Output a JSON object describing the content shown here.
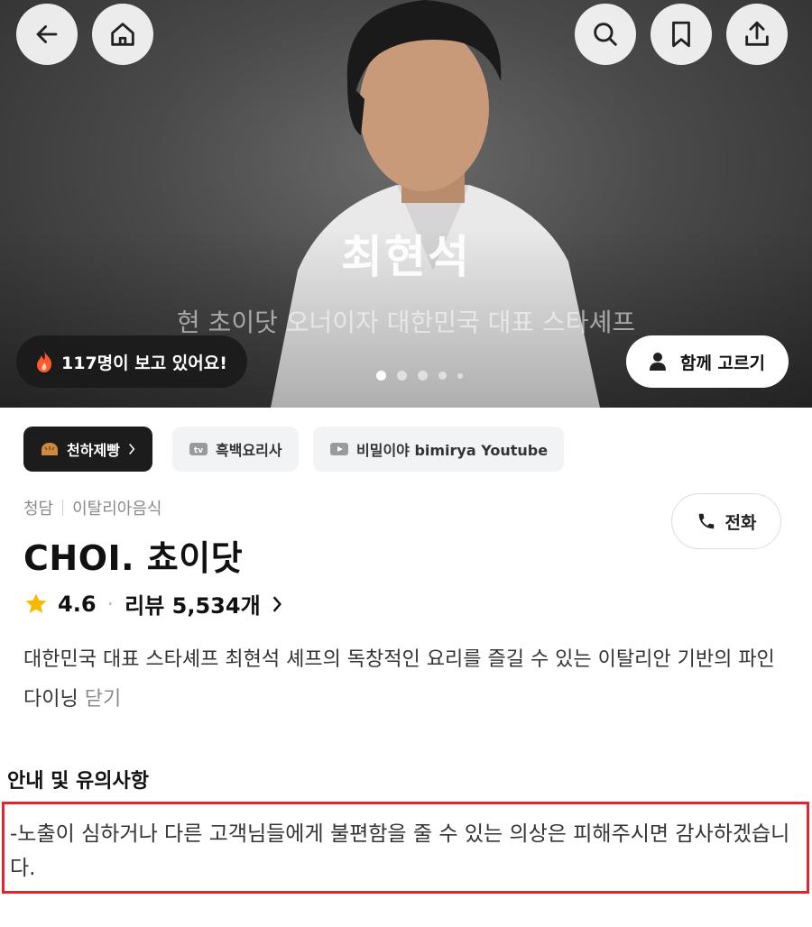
{
  "hero": {
    "title": "최현석",
    "subtitle": "현 초이닷 오너이자 대한민국 대표 스타셰프",
    "viewers": "117명이 보고 있어요!",
    "together_button": "함께 고르기",
    "carousel": {
      "total": 5,
      "active": 1
    }
  },
  "top_actions": {
    "back": "back-icon",
    "home": "home-icon",
    "search": "search-icon",
    "bookmark": "bookmark-icon",
    "share": "share-icon"
  },
  "chips": [
    {
      "label": "천하제빵",
      "icon": "bread-icon"
    },
    {
      "label": "흑백요리사",
      "icon": "tv-icon"
    },
    {
      "label": "비밀이야 bimirya Youtube",
      "icon": "youtube-icon"
    }
  ],
  "info": {
    "area": "청담",
    "cuisine": "이탈리아음식",
    "name": "CHOI. 쵸이닷",
    "rating": "4.6",
    "reviews": "리뷰 5,534개",
    "call": "전화",
    "description": "대한민국 대표 스타셰프 최현석 셰프의 독창적인 요리를 즐길 수 있는 이탈리안 기반의 파인 다이닝",
    "close_link": "닫기"
  },
  "notice": {
    "title": "안내 및 유의사항",
    "text": "-노출이 심하거나 다른 고객님들에게 불편함을 줄 수 있는 의상은 피해주시면 감사하겠습니다."
  },
  "colors": {
    "highlight_border": "#e3262e",
    "star": "#f5b900",
    "flame": "#ff5a2b"
  }
}
